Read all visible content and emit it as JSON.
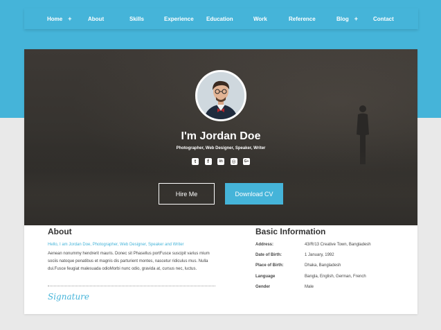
{
  "nav": {
    "items": [
      {
        "label": "Home",
        "plus": "+"
      },
      {
        "label": "About"
      },
      {
        "label": "Skills"
      },
      {
        "label": "Experience"
      },
      {
        "label": "Education"
      },
      {
        "label": "Work"
      },
      {
        "label": "Reference"
      },
      {
        "label": "Blog",
        "plus": "+"
      },
      {
        "label": "Contact"
      }
    ]
  },
  "hero": {
    "name": "I'm Jordan Doe",
    "tagline": "Photographer, Web Designer, Speaker, Writer",
    "socials": [
      {
        "icon": "twitter-icon",
        "glyph": "t"
      },
      {
        "icon": "facebook-icon",
        "glyph": "f"
      },
      {
        "icon": "linkedin-icon",
        "glyph": "in"
      },
      {
        "icon": "instagram-icon",
        "glyph": "◎"
      },
      {
        "icon": "google-plus-icon",
        "glyph": "G+"
      }
    ],
    "hire_label": "Hire Me",
    "cv_label": "Download CV"
  },
  "about": {
    "title": "About",
    "intro": "Hello, I am Jordan Doe, Photographer, Web Designer, Speaker and Writer",
    "body": "Aenean nonummy hendrerit mauris. Donec sit Phasellus portFusce suscipit varius mium sociis natoque penatibus et magnis dis parturient montes, nascetur ridiculus mus. Nulla dui.Fusce feugiat malesuada odioMorbi nunc odio, gravida at, cursus nec, luctus.",
    "signature": "Signature"
  },
  "info": {
    "title": "Basic Information",
    "rows": [
      {
        "label": "Address:",
        "value": "43/R/13 Creative Town, Bangladesh"
      },
      {
        "label": "Date of Birth:",
        "value": "1 January, 1992"
      },
      {
        "label": "Place of Birth:",
        "value": "Dhaka, Bangladesh"
      },
      {
        "label": "Language",
        "value": "Bangla, English, German, French"
      },
      {
        "label": "Gender",
        "value": "Male"
      }
    ]
  },
  "colors": {
    "accent": "#45b4d9",
    "page_bg": "#e9e9e9",
    "hero_bg": "#3a3733"
  }
}
